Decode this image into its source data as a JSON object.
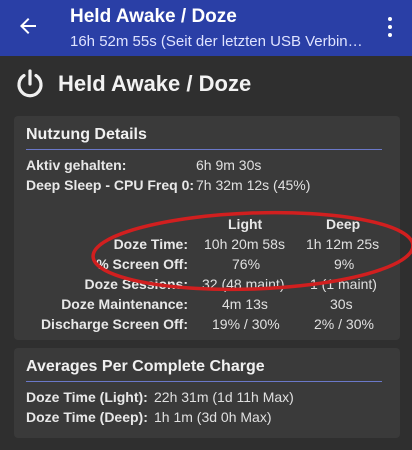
{
  "appbar": {
    "title": "Held Awake / Doze",
    "subtitle": "16h 52m 55s (Seit der letzten USB Verbin…"
  },
  "header": {
    "title": "Held Awake / Doze"
  },
  "usage": {
    "title": "Nutzung Details",
    "awake_label": "Aktiv gehalten:",
    "awake_value": "6h 9m 30s",
    "deep_label": "Deep Sleep - CPU Freq 0:",
    "deep_value": "7h 32m 12s (45%)",
    "columns": {
      "light": "Light",
      "deep": "Deep"
    },
    "rows": [
      {
        "label": "Doze Time:",
        "light": "10h 20m 58s",
        "deep": "1h 12m 25s"
      },
      {
        "label": "% Screen Off:",
        "light": "76%",
        "deep": "9%"
      },
      {
        "label": "Doze Sessions:",
        "light": "32 (48 maint)",
        "deep": "1 (1 maint)"
      },
      {
        "label": "Doze Maintenance:",
        "light": "4m 13s",
        "deep": "30s"
      },
      {
        "label": "Discharge Screen Off:",
        "light": "19% / 30%",
        "deep": "2% / 30%"
      }
    ]
  },
  "averages": {
    "title": "Averages Per Complete Charge",
    "light_label": "Doze Time (Light):",
    "light_value": "22h 31m (1d 11h Max)",
    "deep_label": "Doze Time (Deep):",
    "deep_value": "1h 1m (3d 0h Max)"
  },
  "colors": {
    "appbar": "#2a3fa6",
    "annotation": "#d11f1f",
    "divider": "#6a78c8"
  }
}
